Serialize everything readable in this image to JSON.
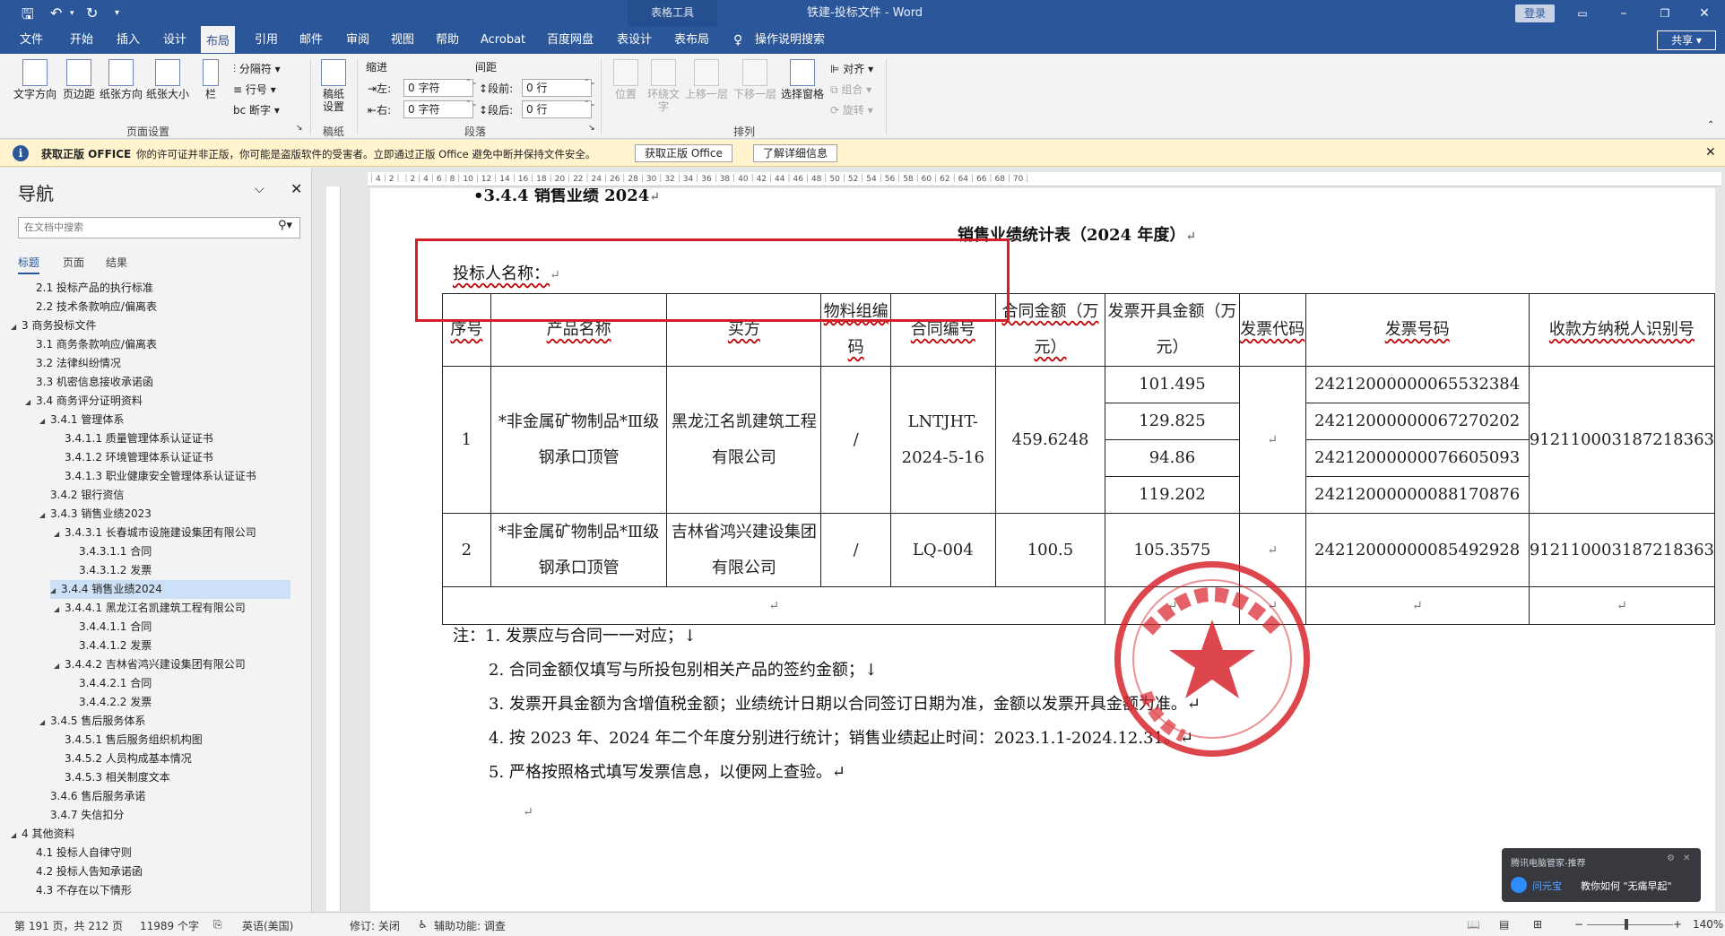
{
  "titlebar": {
    "context_tab": "表格工具",
    "doc_title": "铁建-投标文件 - Word",
    "login": "登录",
    "share": "共享"
  },
  "menu": [
    "文件",
    "开始",
    "插入",
    "设计",
    "布局",
    "引用",
    "邮件",
    "审阅",
    "视图",
    "帮助",
    "Acrobat",
    "百度网盘",
    "表设计",
    "表布局",
    "操作说明搜索"
  ],
  "ribbon": {
    "text_direction": "文字方向",
    "margins": "页边距",
    "orientation": "纸张方向",
    "size": "纸张大小",
    "columns": "栏",
    "breaks": "分隔符",
    "line_numbers": "行号",
    "hyphenation": "断字",
    "group_page_setup": "页面设置",
    "draft_paper": "稿纸\n设置",
    "group_draft": "稿纸",
    "indent_label": "缩进",
    "spacing_label": "间距",
    "left": "左:",
    "right": "右:",
    "before": "段前:",
    "after": "段后:",
    "indent_left": "0 字符",
    "indent_right": "0 字符",
    "space_before": "0 行",
    "space_after": "0 行",
    "group_paragraph": "段落",
    "position": "位置",
    "wrap_text": "环绕文\n字",
    "bring_forward": "上移一层",
    "send_backward": "下移一层",
    "selection_pane": "选择窗格",
    "align": "对齐",
    "group": "组合",
    "rotate": "旋转",
    "group_arrange": "排列"
  },
  "infobar": {
    "title": "获取正版 OFFICE",
    "message": "你的许可证并非正版，你可能是盗版软件的受害者。立即通过正版 Office 避免中断并保持文件安全。",
    "btn_get": "获取正版 Office",
    "btn_learn": "了解详细信息"
  },
  "nav": {
    "title": "导航",
    "search_placeholder": "在文档中搜索",
    "tabs": [
      "标题",
      "页面",
      "结果"
    ],
    "items": [
      {
        "t": "2.1 投标产品的执行标准",
        "l": 2
      },
      {
        "t": "2.2 技术条款响应/偏离表",
        "l": 2
      },
      {
        "t": "3 商务投标文件",
        "l": 1,
        "e": true
      },
      {
        "t": "3.1 商务条款响应/偏离表",
        "l": 2
      },
      {
        "t": "3.2 法律纠纷情况",
        "l": 2
      },
      {
        "t": "3.3 机密信息接收承诺函",
        "l": 2
      },
      {
        "t": "3.4 商务评分证明资料",
        "l": 2,
        "e": true
      },
      {
        "t": "3.4.1 管理体系",
        "l": 3,
        "e": true
      },
      {
        "t": "3.4.1.1 质量管理体系认证证书",
        "l": 4
      },
      {
        "t": "3.4.1.2 环境管理体系认证证书",
        "l": 4
      },
      {
        "t": "3.4.1.3 职业健康安全管理体系认证证书",
        "l": 4
      },
      {
        "t": "3.4.2 银行资信",
        "l": 3
      },
      {
        "t": "3.4.3 销售业绩2023",
        "l": 3,
        "e": true
      },
      {
        "t": "3.4.3.1 长春城市设施建设集团有限公司",
        "l": 4,
        "e": true
      },
      {
        "t": "3.4.3.1.1 合同",
        "l": 5
      },
      {
        "t": "3.4.3.1.2 发票",
        "l": 5
      },
      {
        "t": "3.4.4 销售业绩2024",
        "l": 3,
        "e": true,
        "sel": true
      },
      {
        "t": "3.4.4.1 黑龙江名凯建筑工程有限公司",
        "l": 4,
        "e": true
      },
      {
        "t": "3.4.4.1.1 合同",
        "l": 5
      },
      {
        "t": "3.4.4.1.2 发票",
        "l": 5
      },
      {
        "t": "3.4.4.2 吉林省鸿兴建设集团有限公司",
        "l": 4,
        "e": true
      },
      {
        "t": "3.4.4.2.1 合同",
        "l": 5
      },
      {
        "t": "3.4.4.2.2 发票",
        "l": 5
      },
      {
        "t": "3.4.5 售后服务体系",
        "l": 3,
        "e": true
      },
      {
        "t": "3.4.5.1 售后服务组织机构图",
        "l": 4
      },
      {
        "t": "3.4.5.2 人员构成基本情况",
        "l": 4
      },
      {
        "t": "3.4.5.3 相关制度文本",
        "l": 4
      },
      {
        "t": "3.4.6 售后服务承诺",
        "l": 3
      },
      {
        "t": "3.4.7 失信扣分",
        "l": 3
      },
      {
        "t": "4 其他资料",
        "l": 1,
        "e": true
      },
      {
        "t": "4.1 投标人自律守则",
        "l": 2
      },
      {
        "t": "4.2 投标人告知承诺函",
        "l": 2
      },
      {
        "t": "4.3 不存在以下情形",
        "l": 2
      }
    ]
  },
  "doc": {
    "heading_partial": "3.4.4 销售业绩 2024",
    "table_title": "销售业绩统计表（2024 年度）",
    "bidder": "投标人名称：",
    "headers": [
      "序号",
      "产品名称",
      "买方",
      "物料组编码",
      "合同编号",
      "合同金额（万元）",
      "发票开具金额（万元）",
      "发票代码",
      "发票号码",
      "收款方纳税人识别号"
    ],
    "row1": {
      "no": "1",
      "product": "*非金属矿物制品*Ⅲ级钢承口顶管",
      "buyer": "黑龙江名凯建筑工程有限公司",
      "material": "/",
      "contract": "LNTJHT-2024-5-16",
      "amount": "459.6248",
      "invoices": [
        "101.495",
        "129.825",
        "94.86",
        "119.202"
      ],
      "numbers": [
        "24212000000065532384",
        "24212000000067270202",
        "24212000000076605093",
        "24212000000088170876"
      ],
      "taxid": "912110003187218363"
    },
    "row2": {
      "no": "2",
      "product": "*非金属矿物制品*Ⅲ级钢承口顶管",
      "buyer": "吉林省鸿兴建设集团有限公司",
      "material": "/",
      "contract": "LQ-004",
      "amount": "100.5",
      "invoice": "105.3575",
      "number": "24212000000085492928",
      "taxid": "912110003187218363"
    },
    "notes": [
      "注：1. 发票应与合同一一对应；↓",
      "2. 合同金额仅填写与所投包别相关产品的签约金额；↓",
      "3. 发票开具金额为含增值税金额；业绩统计日期以合同签订日期为准，金额以发票开具金额为准。↵",
      "4. 按 2023 年、2024 年二个年度分别进行统计；销售业绩起止时间：2023.1.1-2024.12.31。↵",
      "5. 严格按照格式填写发票信息，以便网上查验。↵"
    ]
  },
  "status": {
    "page": "第 191 页，共 212 页",
    "words": "11989 个字",
    "lang": "英语(美国)",
    "track": "修订: 关闭",
    "access": "辅助功能: 调查",
    "zoom": "140%"
  },
  "toast": {
    "title": "腾讯电脑管家-推荐",
    "name": "问元宝",
    "msg": "教你如何 \"无痛早起\""
  },
  "colors": {
    "brand": "#2b579a",
    "stamp": "#d9262e",
    "highlight": "#d41f2a"
  }
}
